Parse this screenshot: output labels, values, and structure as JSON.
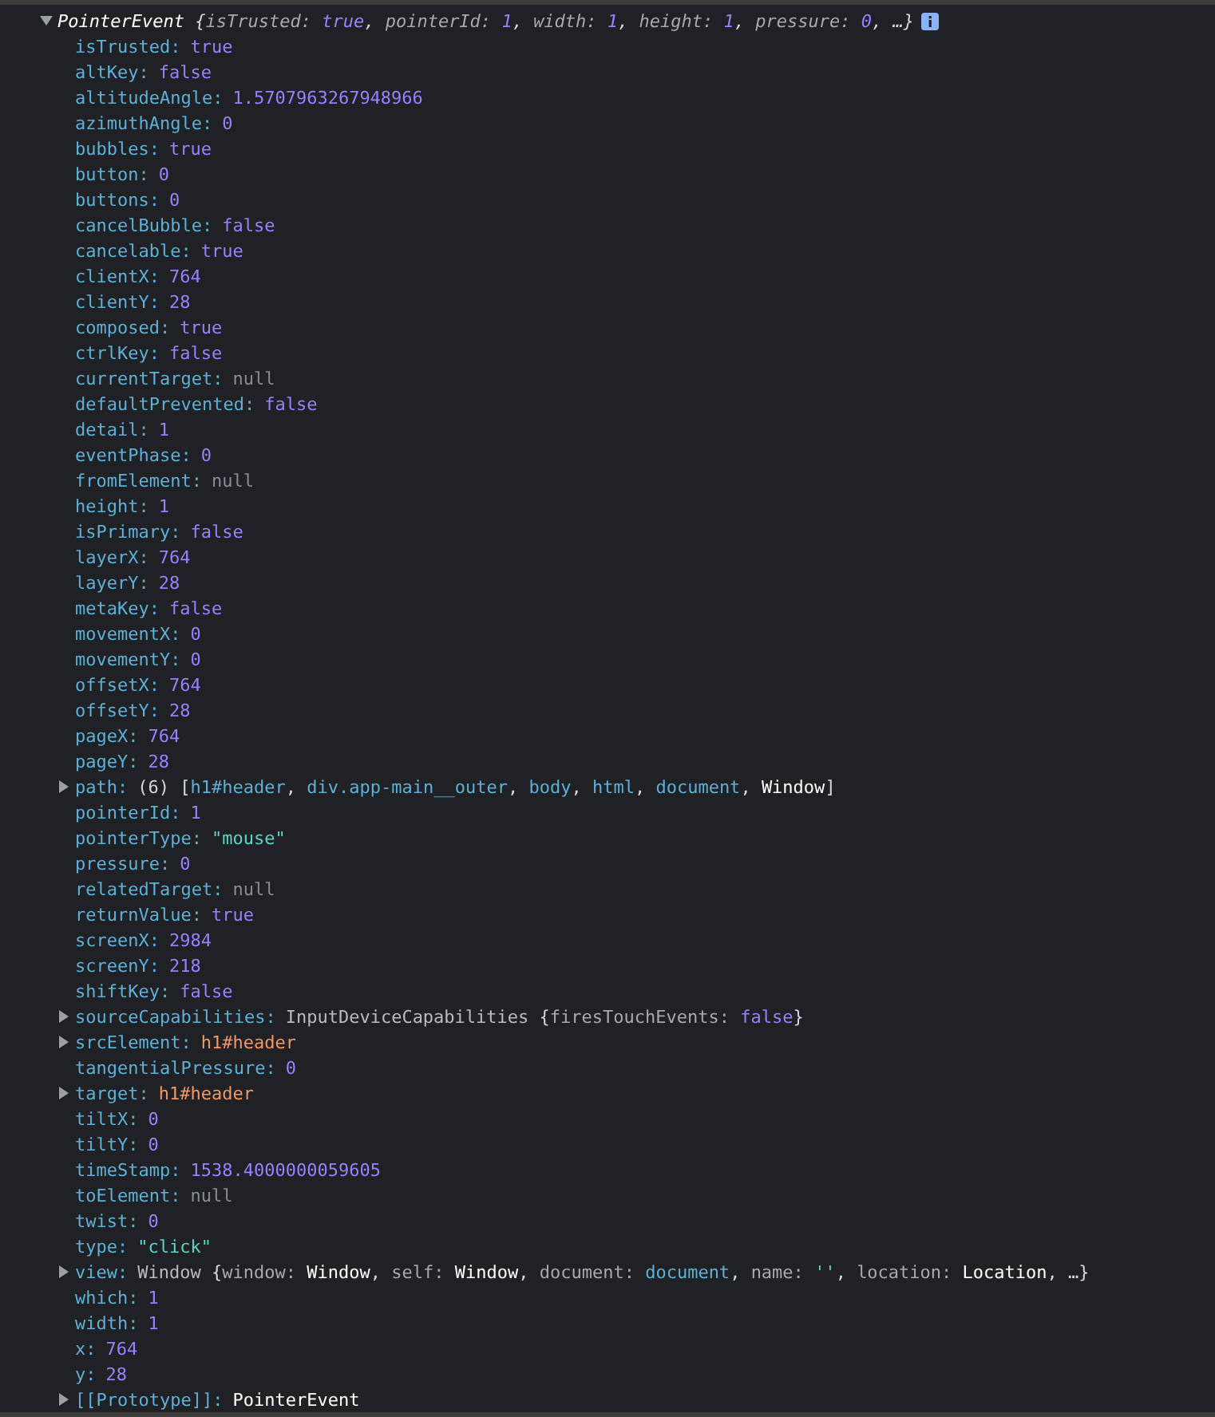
{
  "header": {
    "expanded": true,
    "tokens": [
      {
        "text": "PointerEvent ",
        "kind": "obj"
      },
      {
        "text": "{",
        "kind": "punct"
      },
      {
        "text": "isTrusted: ",
        "kind": "key"
      },
      {
        "text": "true",
        "kind": "num"
      },
      {
        "text": ", ",
        "kind": "punct"
      },
      {
        "text": "pointerId: ",
        "kind": "key"
      },
      {
        "text": "1",
        "kind": "num"
      },
      {
        "text": ", ",
        "kind": "punct"
      },
      {
        "text": "width: ",
        "kind": "key"
      },
      {
        "text": "1",
        "kind": "num"
      },
      {
        "text": ", ",
        "kind": "punct"
      },
      {
        "text": "height: ",
        "kind": "key"
      },
      {
        "text": "1",
        "kind": "num"
      },
      {
        "text": ", ",
        "kind": "punct"
      },
      {
        "text": "pressure: ",
        "kind": "key"
      },
      {
        "text": "0",
        "kind": "num"
      },
      {
        "text": ", …}",
        "kind": "punct"
      }
    ]
  },
  "properties": [
    {
      "key": "isTrusted:",
      "value": [
        {
          "text": "true",
          "kind": "num"
        }
      ]
    },
    {
      "key": "altKey:",
      "value": [
        {
          "text": "false",
          "kind": "num"
        }
      ]
    },
    {
      "key": "altitudeAngle:",
      "value": [
        {
          "text": "1.5707963267948966",
          "kind": "num"
        }
      ]
    },
    {
      "key": "azimuthAngle:",
      "value": [
        {
          "text": "0",
          "kind": "num"
        }
      ]
    },
    {
      "key": "bubbles:",
      "value": [
        {
          "text": "true",
          "kind": "num"
        }
      ]
    },
    {
      "key": "button:",
      "value": [
        {
          "text": "0",
          "kind": "num"
        }
      ]
    },
    {
      "key": "buttons:",
      "value": [
        {
          "text": "0",
          "kind": "num"
        }
      ]
    },
    {
      "key": "cancelBubble:",
      "value": [
        {
          "text": "false",
          "kind": "num"
        }
      ]
    },
    {
      "key": "cancelable:",
      "value": [
        {
          "text": "true",
          "kind": "num"
        }
      ]
    },
    {
      "key": "clientX:",
      "value": [
        {
          "text": "764",
          "kind": "num"
        }
      ]
    },
    {
      "key": "clientY:",
      "value": [
        {
          "text": "28",
          "kind": "num"
        }
      ]
    },
    {
      "key": "composed:",
      "value": [
        {
          "text": "true",
          "kind": "num"
        }
      ]
    },
    {
      "key": "ctrlKey:",
      "value": [
        {
          "text": "false",
          "kind": "num"
        }
      ]
    },
    {
      "key": "currentTarget:",
      "value": [
        {
          "text": "null",
          "kind": "null"
        }
      ]
    },
    {
      "key": "defaultPrevented:",
      "value": [
        {
          "text": "false",
          "kind": "num"
        }
      ]
    },
    {
      "key": "detail:",
      "value": [
        {
          "text": "1",
          "kind": "num"
        }
      ]
    },
    {
      "key": "eventPhase:",
      "value": [
        {
          "text": "0",
          "kind": "num"
        }
      ]
    },
    {
      "key": "fromElement:",
      "value": [
        {
          "text": "null",
          "kind": "null"
        }
      ]
    },
    {
      "key": "height:",
      "value": [
        {
          "text": "1",
          "kind": "num"
        }
      ]
    },
    {
      "key": "isPrimary:",
      "value": [
        {
          "text": "false",
          "kind": "num"
        }
      ]
    },
    {
      "key": "layerX:",
      "value": [
        {
          "text": "764",
          "kind": "num"
        }
      ]
    },
    {
      "key": "layerY:",
      "value": [
        {
          "text": "28",
          "kind": "num"
        }
      ]
    },
    {
      "key": "metaKey:",
      "value": [
        {
          "text": "false",
          "kind": "num"
        }
      ]
    },
    {
      "key": "movementX:",
      "value": [
        {
          "text": "0",
          "kind": "num"
        }
      ]
    },
    {
      "key": "movementY:",
      "value": [
        {
          "text": "0",
          "kind": "num"
        }
      ]
    },
    {
      "key": "offsetX:",
      "value": [
        {
          "text": "764",
          "kind": "num"
        }
      ]
    },
    {
      "key": "offsetY:",
      "value": [
        {
          "text": "28",
          "kind": "num"
        }
      ]
    },
    {
      "key": "pageX:",
      "value": [
        {
          "text": "764",
          "kind": "num"
        }
      ]
    },
    {
      "key": "pageY:",
      "value": [
        {
          "text": "28",
          "kind": "num"
        }
      ]
    },
    {
      "key": "path:",
      "expanded": false,
      "value": [
        {
          "text": "(6) [",
          "kind": "punct"
        },
        {
          "text": "h1#header",
          "kind": "ref"
        },
        {
          "text": ", ",
          "kind": "punct"
        },
        {
          "text": "div.app-main__outer",
          "kind": "ref"
        },
        {
          "text": ", ",
          "kind": "punct"
        },
        {
          "text": "body",
          "kind": "ref"
        },
        {
          "text": ", ",
          "kind": "punct"
        },
        {
          "text": "html",
          "kind": "ref"
        },
        {
          "text": ", ",
          "kind": "punct"
        },
        {
          "text": "document",
          "kind": "ref"
        },
        {
          "text": ", ",
          "kind": "punct"
        },
        {
          "text": "Window",
          "kind": "obj"
        },
        {
          "text": "]",
          "kind": "punct"
        }
      ]
    },
    {
      "key": "pointerId:",
      "value": [
        {
          "text": "1",
          "kind": "num"
        }
      ]
    },
    {
      "key": "pointerType:",
      "value": [
        {
          "text": "\"mouse\"",
          "kind": "str"
        }
      ]
    },
    {
      "key": "pressure:",
      "value": [
        {
          "text": "0",
          "kind": "num"
        }
      ]
    },
    {
      "key": "relatedTarget:",
      "value": [
        {
          "text": "null",
          "kind": "null"
        }
      ]
    },
    {
      "key": "returnValue:",
      "value": [
        {
          "text": "true",
          "kind": "num"
        }
      ]
    },
    {
      "key": "screenX:",
      "value": [
        {
          "text": "2984",
          "kind": "num"
        }
      ]
    },
    {
      "key": "screenY:",
      "value": [
        {
          "text": "218",
          "kind": "num"
        }
      ]
    },
    {
      "key": "shiftKey:",
      "value": [
        {
          "text": "false",
          "kind": "num"
        }
      ]
    },
    {
      "key": "sourceCapabilities:",
      "expanded": false,
      "value": [
        {
          "text": "InputDeviceCapabilities ",
          "kind": "type"
        },
        {
          "text": "{",
          "kind": "punct"
        },
        {
          "text": "firesTouchEvents: ",
          "kind": "key"
        },
        {
          "text": "false",
          "kind": "num"
        },
        {
          "text": "}",
          "kind": "punct"
        }
      ]
    },
    {
      "key": "srcElement:",
      "expanded": false,
      "value": [
        {
          "text": "h1#header",
          "kind": "node"
        }
      ]
    },
    {
      "key": "tangentialPressure:",
      "value": [
        {
          "text": "0",
          "kind": "num"
        }
      ]
    },
    {
      "key": "target:",
      "expanded": false,
      "value": [
        {
          "text": "h1#header",
          "kind": "node"
        }
      ]
    },
    {
      "key": "tiltX:",
      "value": [
        {
          "text": "0",
          "kind": "num"
        }
      ]
    },
    {
      "key": "tiltY:",
      "value": [
        {
          "text": "0",
          "kind": "num"
        }
      ]
    },
    {
      "key": "timeStamp:",
      "value": [
        {
          "text": "1538.4000000059605",
          "kind": "num"
        }
      ]
    },
    {
      "key": "toElement:",
      "value": [
        {
          "text": "null",
          "kind": "null"
        }
      ]
    },
    {
      "key": "twist:",
      "value": [
        {
          "text": "0",
          "kind": "num"
        }
      ]
    },
    {
      "key": "type:",
      "value": [
        {
          "text": "\"click\"",
          "kind": "str"
        }
      ]
    },
    {
      "key": "view:",
      "expanded": false,
      "value": [
        {
          "text": "Window ",
          "kind": "type"
        },
        {
          "text": "{",
          "kind": "punct"
        },
        {
          "text": "window: ",
          "kind": "key"
        },
        {
          "text": "Window",
          "kind": "obj"
        },
        {
          "text": ", ",
          "kind": "punct"
        },
        {
          "text": "self: ",
          "kind": "key"
        },
        {
          "text": "Window",
          "kind": "obj"
        },
        {
          "text": ", ",
          "kind": "punct"
        },
        {
          "text": "document: ",
          "kind": "key"
        },
        {
          "text": "document",
          "kind": "ref"
        },
        {
          "text": ", ",
          "kind": "punct"
        },
        {
          "text": "name: ",
          "kind": "key"
        },
        {
          "text": "''",
          "kind": "str"
        },
        {
          "text": ", ",
          "kind": "punct"
        },
        {
          "text": "location: ",
          "kind": "key"
        },
        {
          "text": "Location",
          "kind": "obj"
        },
        {
          "text": ", …}",
          "kind": "punct"
        }
      ]
    },
    {
      "key": "which:",
      "value": [
        {
          "text": "1",
          "kind": "num"
        }
      ]
    },
    {
      "key": "width:",
      "value": [
        {
          "text": "1",
          "kind": "num"
        }
      ]
    },
    {
      "key": "x:",
      "value": [
        {
          "text": "764",
          "kind": "num"
        }
      ]
    },
    {
      "key": "y:",
      "value": [
        {
          "text": "28",
          "kind": "num"
        }
      ]
    },
    {
      "key": "[[Prototype]]:",
      "expanded": false,
      "value": [
        {
          "text": "PointerEvent",
          "kind": "obj"
        }
      ]
    }
  ]
}
